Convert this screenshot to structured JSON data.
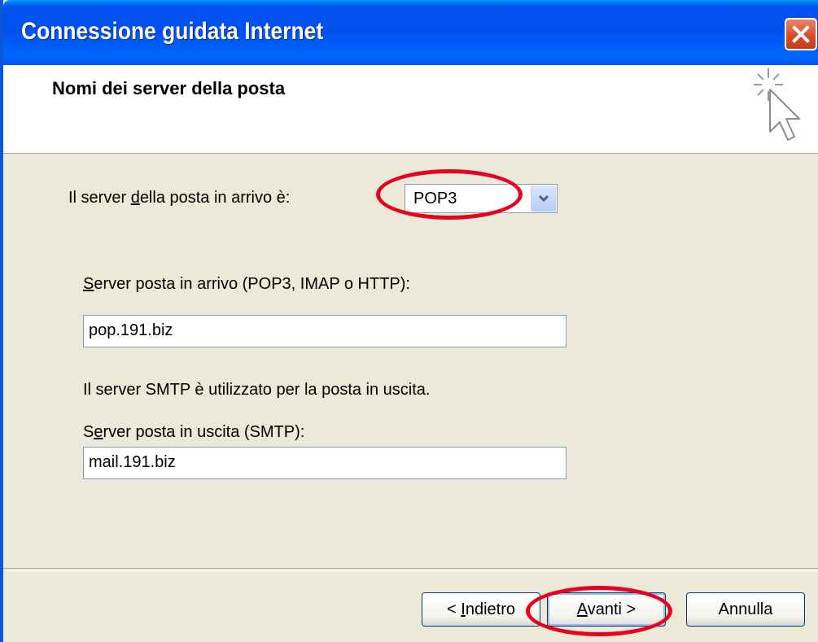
{
  "window": {
    "title": "Connessione guidata Internet",
    "close_icon": "close-icon"
  },
  "header": {
    "heading": "Nomi dei server della posta",
    "icon": "wizard-cursor-icon"
  },
  "form": {
    "incoming_type": {
      "label_pre": "Il server ",
      "label_accel": "d",
      "label_post": "ella posta in arrivo è:",
      "value": "POP3"
    },
    "incoming_server": {
      "label_accel": "S",
      "label_post": "erver posta in arrivo (POP3, IMAP o HTTP):",
      "value": "pop.191.biz"
    },
    "smtp_note": "Il server SMTP è utilizzato per la posta in uscita.",
    "outgoing_server": {
      "label_pre": "S",
      "label_accel": "e",
      "label_post": "rver posta in uscita (SMTP):",
      "value": "mail.191.biz"
    }
  },
  "buttons": {
    "back": {
      "pre": "< ",
      "accel": "I",
      "post": "ndietro"
    },
    "next": {
      "accel": "A",
      "post": "vanti >"
    },
    "cancel": "Annulla"
  },
  "colors": {
    "titlebar": "#0054E3",
    "dialog_bg": "#ECE9D8",
    "annotation": "#E8001C"
  }
}
